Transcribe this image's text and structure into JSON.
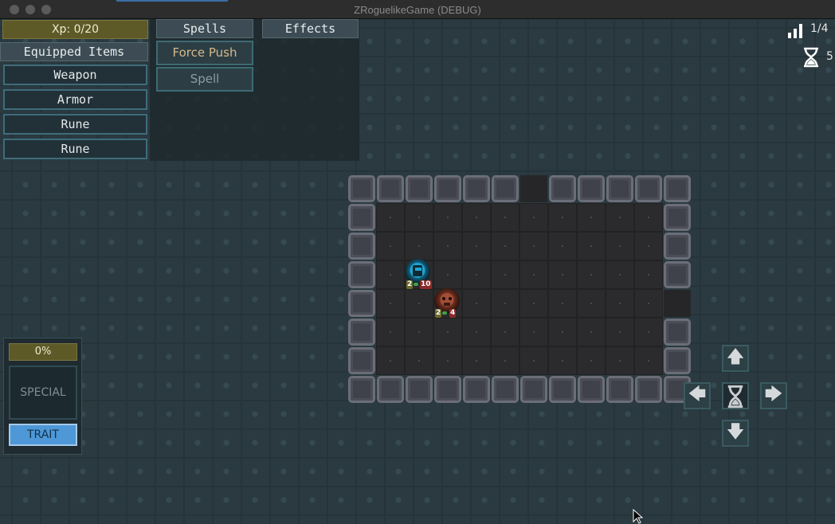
{
  "window": {
    "title": "ZRoguelikeGame (DEBUG)"
  },
  "xp": {
    "label": "Xp: 0/20"
  },
  "equipped": {
    "header": "Equipped Items",
    "slots": [
      "Weapon",
      "Armor",
      "Rune",
      "Rune"
    ]
  },
  "tabs": {
    "spells": "Spells",
    "effects": "Effects"
  },
  "spells": [
    {
      "label": "Force Push",
      "color": "#d6b88a"
    },
    {
      "label": "Spell",
      "color": "#8c9ea3"
    }
  ],
  "hud": {
    "level": "1/4",
    "turns": "5"
  },
  "player": {
    "level": "2",
    "hp": "10",
    "color": "#1fa4d1"
  },
  "enemy": {
    "level": "2",
    "hp": "4",
    "color": "#8a3e2a"
  },
  "special": {
    "percent": "0%",
    "label": "SPECIAL",
    "trait_label": "TRAIT"
  },
  "dpad": {
    "up": "🡅",
    "down": "🡇",
    "left": "🡄",
    "right": "🡆",
    "wait_icon": "hourglass-icon"
  },
  "colors": {
    "xp_bar": "#5d5a28",
    "trait": "#4e98d8",
    "background": "#2a3a40"
  }
}
